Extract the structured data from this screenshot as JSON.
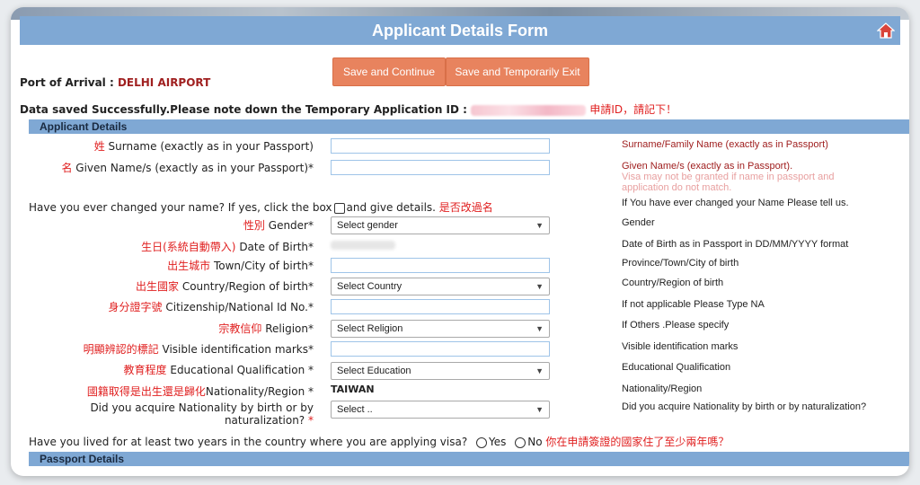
{
  "form": {
    "title": "Applicant Details Form",
    "save_continue": "Save and Continue",
    "save_exit": "Save and Temporarily Exit",
    "port_label": "Port of Arrival :",
    "port_value": "DELHI AIRPORT",
    "saved_msg": "Data saved Successfully.Please note down the Temporary Application ID :",
    "saved_note_zh": "申請ID，請記下！",
    "section_applicant": "Applicant Details",
    "section_passport": "Passport Details"
  },
  "fields": {
    "surname": {
      "zh": "姓",
      "label": "Surname (exactly as in your Passport)",
      "help": "Surname/Family Name (exactly as in Passport)"
    },
    "given": {
      "zh": "名",
      "label": "Given Name/s (exactly as in your Passport)*",
      "help": "Given Name/s (exactly as in Passport).",
      "note": "Visa may not be granted if name in passport and application do not match."
    },
    "changed": {
      "label": "Have you ever changed your name? If yes, click the box",
      "label2": "and give details.",
      "zh": "是否改過名",
      "help": "If You have ever changed your Name Please tell us."
    },
    "gender": {
      "zh": "性別",
      "label": "Gender*",
      "value": "Select gender",
      "help": "Gender"
    },
    "dob": {
      "zh": "生日(系統自動帶入)",
      "label": "Date of Birth*",
      "help": "Date of Birth as in Passport in DD/MM/YYYY format"
    },
    "town": {
      "zh": "出生城市",
      "label": "Town/City of birth*",
      "help": "Province/Town/City of birth"
    },
    "country": {
      "zh": "出生國家",
      "label": "Country/Region of birth*",
      "value": "Select Country",
      "help": "Country/Region of birth"
    },
    "natid": {
      "zh": "身分證字號",
      "label": "Citizenship/National Id No.*",
      "help": "If not applicable Please Type NA"
    },
    "religion": {
      "zh": "宗教信仰",
      "label": "Religion*",
      "value": "Select Religion",
      "help": "If Others .Please specify"
    },
    "marks": {
      "zh": "明顯辨認的標記",
      "label": "Visible identification marks*",
      "help": "Visible identification marks"
    },
    "education": {
      "zh": "教育程度",
      "label": "Educational Qualification *",
      "value": "Select Education",
      "help": "Educational Qualification"
    },
    "nationality": {
      "zh": "國籍取得是出生還是歸化",
      "label": "Nationality/Region *",
      "value": "TAIWAN",
      "help": "Nationality/Region"
    },
    "acquire": {
      "label1": "Did you acquire Nationality by birth or by",
      "label2": "naturalization?",
      "value": "Select ..",
      "help": "Did you acquire Nationality by birth or by naturalization?"
    },
    "lived": {
      "label": "Have you lived for at least two years in the country where you are applying visa?",
      "yes": "Yes",
      "no": "No",
      "zh": "你在申請簽證的國家住了至少兩年嗎？"
    }
  },
  "colors": {
    "header": "#7fa8d4",
    "button": "#e8835e",
    "annotation": "#e02020"
  }
}
